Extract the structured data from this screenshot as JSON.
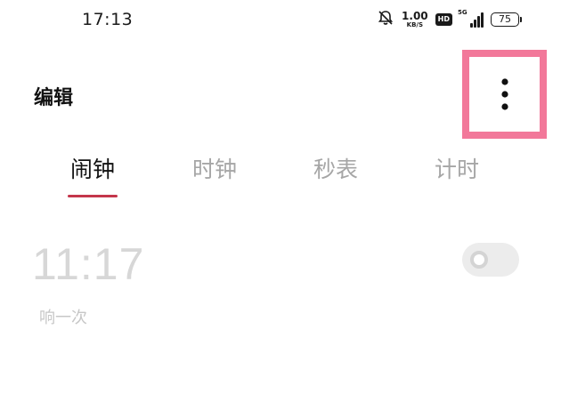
{
  "status_bar": {
    "time": "17:13",
    "net_speed_value": "1.00",
    "net_speed_unit": "KB/S",
    "hd_badge": "HD",
    "network_gen": "5G",
    "battery_level": "75",
    "icons": [
      "bell-off-icon",
      "signal-icon",
      "battery-icon"
    ]
  },
  "app_bar": {
    "title": "编辑",
    "more_icon": "more-vertical-icon",
    "highlight_color": "#f2789a"
  },
  "tabs": [
    {
      "label": "闹钟",
      "active": true
    },
    {
      "label": "时钟",
      "active": false
    },
    {
      "label": "秒表",
      "active": false
    },
    {
      "label": "计时",
      "active": false
    }
  ],
  "tab_indicator_color": "#c4364b",
  "alarm": {
    "time": "11:17",
    "repeat": "响一次",
    "enabled": false
  }
}
